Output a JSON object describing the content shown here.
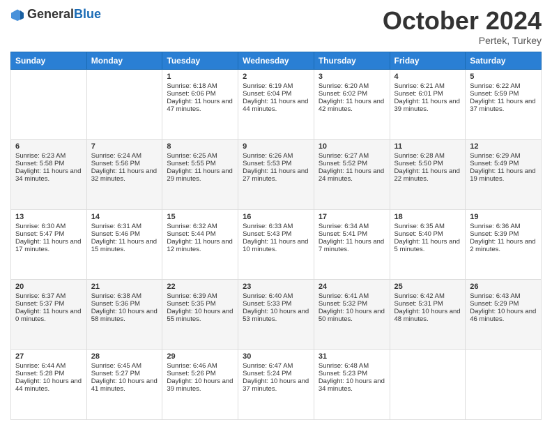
{
  "header": {
    "logo_general": "General",
    "logo_blue": "Blue",
    "month_title": "October 2024",
    "location": "Pertek, Turkey"
  },
  "days_of_week": [
    "Sunday",
    "Monday",
    "Tuesday",
    "Wednesday",
    "Thursday",
    "Friday",
    "Saturday"
  ],
  "weeks": [
    [
      {
        "day": "",
        "sunrise": "",
        "sunset": "",
        "daylight": ""
      },
      {
        "day": "",
        "sunrise": "",
        "sunset": "",
        "daylight": ""
      },
      {
        "day": "1",
        "sunrise": "Sunrise: 6:18 AM",
        "sunset": "Sunset: 6:06 PM",
        "daylight": "Daylight: 11 hours and 47 minutes."
      },
      {
        "day": "2",
        "sunrise": "Sunrise: 6:19 AM",
        "sunset": "Sunset: 6:04 PM",
        "daylight": "Daylight: 11 hours and 44 minutes."
      },
      {
        "day": "3",
        "sunrise": "Sunrise: 6:20 AM",
        "sunset": "Sunset: 6:02 PM",
        "daylight": "Daylight: 11 hours and 42 minutes."
      },
      {
        "day": "4",
        "sunrise": "Sunrise: 6:21 AM",
        "sunset": "Sunset: 6:01 PM",
        "daylight": "Daylight: 11 hours and 39 minutes."
      },
      {
        "day": "5",
        "sunrise": "Sunrise: 6:22 AM",
        "sunset": "Sunset: 5:59 PM",
        "daylight": "Daylight: 11 hours and 37 minutes."
      }
    ],
    [
      {
        "day": "6",
        "sunrise": "Sunrise: 6:23 AM",
        "sunset": "Sunset: 5:58 PM",
        "daylight": "Daylight: 11 hours and 34 minutes."
      },
      {
        "day": "7",
        "sunrise": "Sunrise: 6:24 AM",
        "sunset": "Sunset: 5:56 PM",
        "daylight": "Daylight: 11 hours and 32 minutes."
      },
      {
        "day": "8",
        "sunrise": "Sunrise: 6:25 AM",
        "sunset": "Sunset: 5:55 PM",
        "daylight": "Daylight: 11 hours and 29 minutes."
      },
      {
        "day": "9",
        "sunrise": "Sunrise: 6:26 AM",
        "sunset": "Sunset: 5:53 PM",
        "daylight": "Daylight: 11 hours and 27 minutes."
      },
      {
        "day": "10",
        "sunrise": "Sunrise: 6:27 AM",
        "sunset": "Sunset: 5:52 PM",
        "daylight": "Daylight: 11 hours and 24 minutes."
      },
      {
        "day": "11",
        "sunrise": "Sunrise: 6:28 AM",
        "sunset": "Sunset: 5:50 PM",
        "daylight": "Daylight: 11 hours and 22 minutes."
      },
      {
        "day": "12",
        "sunrise": "Sunrise: 6:29 AM",
        "sunset": "Sunset: 5:49 PM",
        "daylight": "Daylight: 11 hours and 19 minutes."
      }
    ],
    [
      {
        "day": "13",
        "sunrise": "Sunrise: 6:30 AM",
        "sunset": "Sunset: 5:47 PM",
        "daylight": "Daylight: 11 hours and 17 minutes."
      },
      {
        "day": "14",
        "sunrise": "Sunrise: 6:31 AM",
        "sunset": "Sunset: 5:46 PM",
        "daylight": "Daylight: 11 hours and 15 minutes."
      },
      {
        "day": "15",
        "sunrise": "Sunrise: 6:32 AM",
        "sunset": "Sunset: 5:44 PM",
        "daylight": "Daylight: 11 hours and 12 minutes."
      },
      {
        "day": "16",
        "sunrise": "Sunrise: 6:33 AM",
        "sunset": "Sunset: 5:43 PM",
        "daylight": "Daylight: 11 hours and 10 minutes."
      },
      {
        "day": "17",
        "sunrise": "Sunrise: 6:34 AM",
        "sunset": "Sunset: 5:41 PM",
        "daylight": "Daylight: 11 hours and 7 minutes."
      },
      {
        "day": "18",
        "sunrise": "Sunrise: 6:35 AM",
        "sunset": "Sunset: 5:40 PM",
        "daylight": "Daylight: 11 hours and 5 minutes."
      },
      {
        "day": "19",
        "sunrise": "Sunrise: 6:36 AM",
        "sunset": "Sunset: 5:39 PM",
        "daylight": "Daylight: 11 hours and 2 minutes."
      }
    ],
    [
      {
        "day": "20",
        "sunrise": "Sunrise: 6:37 AM",
        "sunset": "Sunset: 5:37 PM",
        "daylight": "Daylight: 11 hours and 0 minutes."
      },
      {
        "day": "21",
        "sunrise": "Sunrise: 6:38 AM",
        "sunset": "Sunset: 5:36 PM",
        "daylight": "Daylight: 10 hours and 58 minutes."
      },
      {
        "day": "22",
        "sunrise": "Sunrise: 6:39 AM",
        "sunset": "Sunset: 5:35 PM",
        "daylight": "Daylight: 10 hours and 55 minutes."
      },
      {
        "day": "23",
        "sunrise": "Sunrise: 6:40 AM",
        "sunset": "Sunset: 5:33 PM",
        "daylight": "Daylight: 10 hours and 53 minutes."
      },
      {
        "day": "24",
        "sunrise": "Sunrise: 6:41 AM",
        "sunset": "Sunset: 5:32 PM",
        "daylight": "Daylight: 10 hours and 50 minutes."
      },
      {
        "day": "25",
        "sunrise": "Sunrise: 6:42 AM",
        "sunset": "Sunset: 5:31 PM",
        "daylight": "Daylight: 10 hours and 48 minutes."
      },
      {
        "day": "26",
        "sunrise": "Sunrise: 6:43 AM",
        "sunset": "Sunset: 5:29 PM",
        "daylight": "Daylight: 10 hours and 46 minutes."
      }
    ],
    [
      {
        "day": "27",
        "sunrise": "Sunrise: 6:44 AM",
        "sunset": "Sunset: 5:28 PM",
        "daylight": "Daylight: 10 hours and 44 minutes."
      },
      {
        "day": "28",
        "sunrise": "Sunrise: 6:45 AM",
        "sunset": "Sunset: 5:27 PM",
        "daylight": "Daylight: 10 hours and 41 minutes."
      },
      {
        "day": "29",
        "sunrise": "Sunrise: 6:46 AM",
        "sunset": "Sunset: 5:26 PM",
        "daylight": "Daylight: 10 hours and 39 minutes."
      },
      {
        "day": "30",
        "sunrise": "Sunrise: 6:47 AM",
        "sunset": "Sunset: 5:24 PM",
        "daylight": "Daylight: 10 hours and 37 minutes."
      },
      {
        "day": "31",
        "sunrise": "Sunrise: 6:48 AM",
        "sunset": "Sunset: 5:23 PM",
        "daylight": "Daylight: 10 hours and 34 minutes."
      },
      {
        "day": "",
        "sunrise": "",
        "sunset": "",
        "daylight": ""
      },
      {
        "day": "",
        "sunrise": "",
        "sunset": "",
        "daylight": ""
      }
    ]
  ]
}
